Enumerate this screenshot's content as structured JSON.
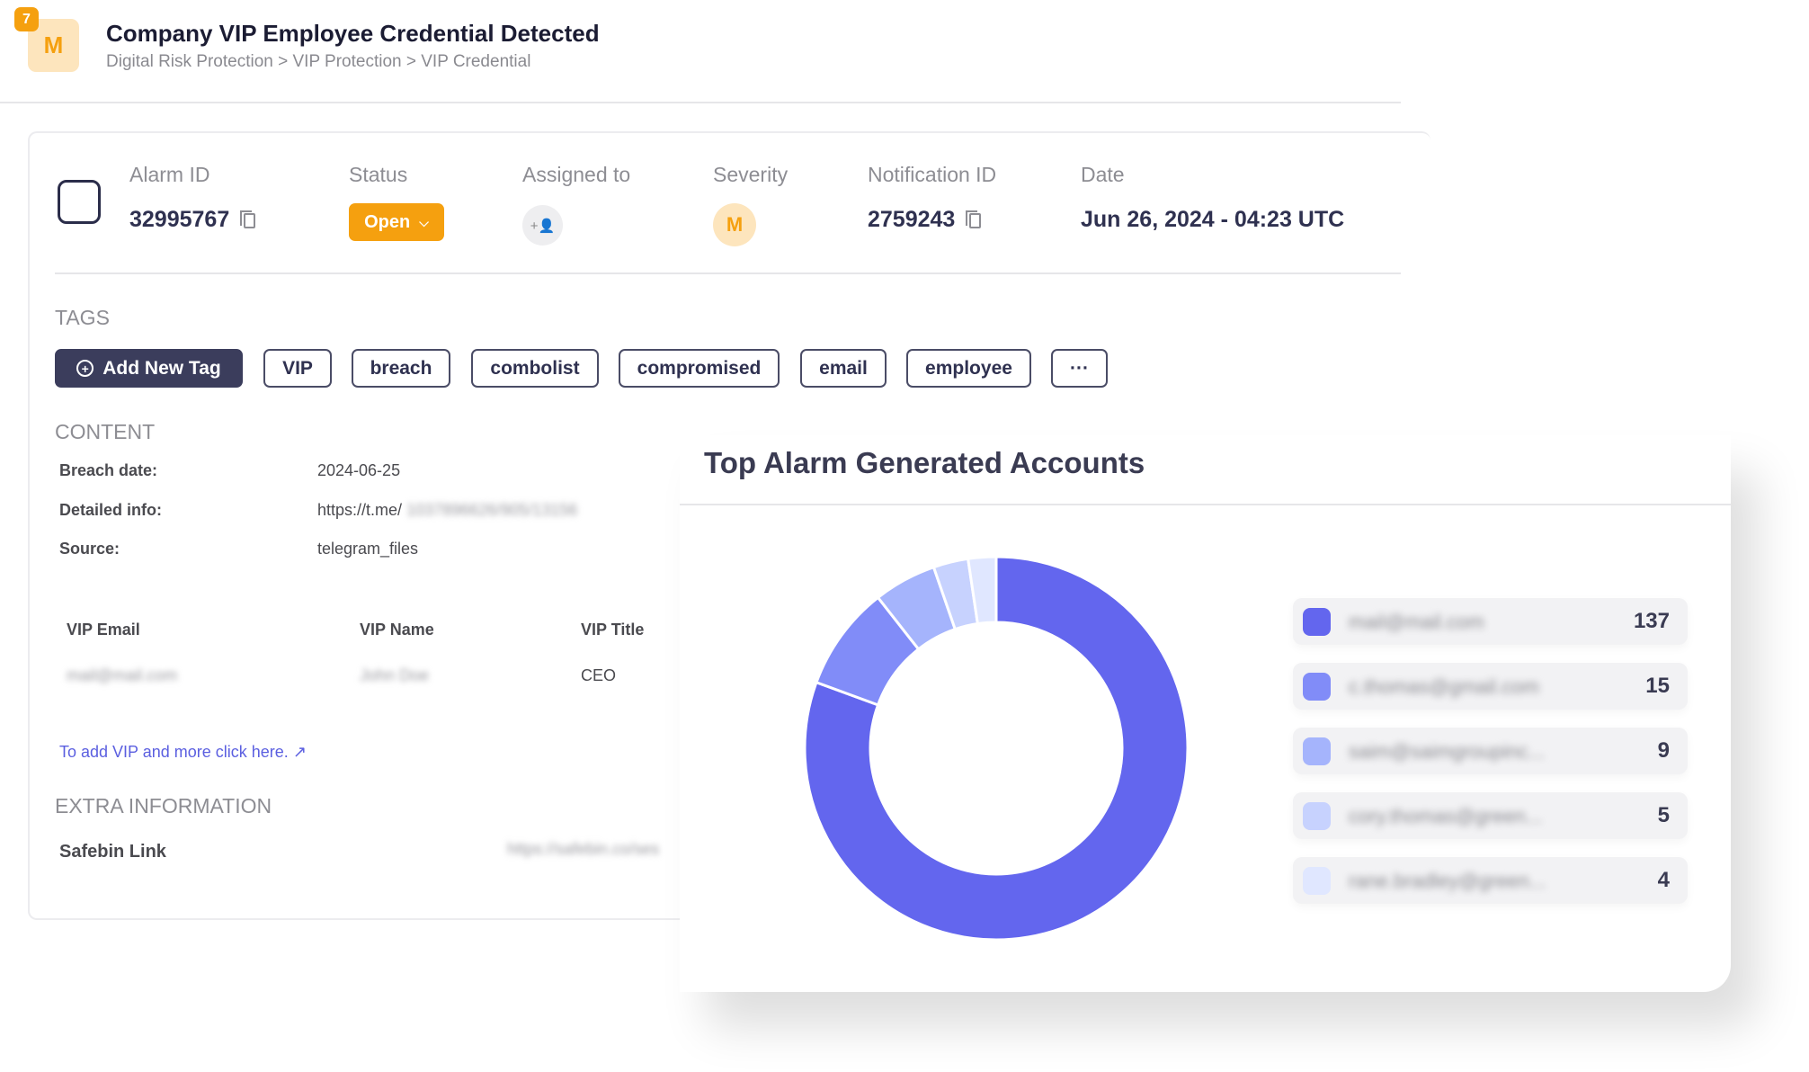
{
  "header": {
    "badge_count": "7",
    "avatar_letter": "M",
    "title": "Company VIP Employee Credential Detected",
    "breadcrumb": "Digital Risk Protection > VIP Protection > VIP Credential"
  },
  "alarm": {
    "labels": {
      "alarm_id": "Alarm ID",
      "status": "Status",
      "assigned": "Assigned to",
      "severity": "Severity",
      "notification_id": "Notification ID",
      "date": "Date"
    },
    "alarm_id": "32995767",
    "status": "Open",
    "severity": "M",
    "notification_id": "2759243",
    "date": "Jun 26, 2024 - 04:23 UTC",
    "assign_icon": "+👤"
  },
  "tags": {
    "heading": "TAGS",
    "add_label": "Add New Tag",
    "items": [
      "VIP",
      "breach",
      "combolist",
      "compromised",
      "email",
      "employee"
    ],
    "more": "···"
  },
  "content": {
    "heading": "CONTENT",
    "rows": [
      {
        "k": "Breach date:",
        "v": "2024-06-25"
      },
      {
        "k": "Detailed info:",
        "v": "https://t.me/",
        "v_hidden": "1037896626/905/13156"
      },
      {
        "k": "Source:",
        "v": "telegram_files"
      }
    ],
    "table": {
      "headers": [
        "VIP Email",
        "VIP Name",
        "VIP Title"
      ],
      "row": [
        "mail@mail.com",
        "John Doe",
        "CEO"
      ]
    },
    "link": "To add VIP and more click here."
  },
  "extra": {
    "heading": "EXTRA INFORMATION",
    "safebin_label": "Safebin Link",
    "safebin_value": "https://safebin.co/ses"
  },
  "chart_data": {
    "type": "pie",
    "title": "Top Alarm Generated Accounts",
    "donut": true,
    "categories": [
      "mail@mail.com",
      "c.thomas@gmail.com",
      "saim@saimgroupinc...",
      "cory.thomas@green...",
      "rane.bradley@green..."
    ],
    "values": [
      137,
      15,
      9,
      5,
      4
    ],
    "colors": [
      "#6366ee",
      "#818cf8",
      "#a5b4fc",
      "#c7d2fe",
      "#e0e7ff"
    ],
    "legend": "right"
  }
}
